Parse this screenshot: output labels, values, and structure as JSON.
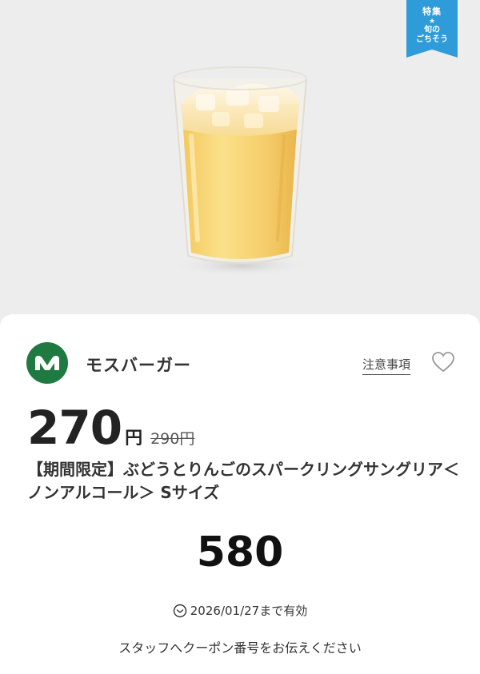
{
  "ribbon": {
    "line1": "特集",
    "star": "★",
    "line2": "旬の",
    "line3": "ごちそう"
  },
  "shop": {
    "name": "モスバーガー",
    "logo_icon": "mos-logo-icon",
    "brand_color": "#1e7a40"
  },
  "actions": {
    "notice_label": "注意事項",
    "favorite_icon": "heart-outline-icon"
  },
  "price": {
    "current": "270",
    "yen": "円",
    "original": "290円"
  },
  "product": {
    "title": "【期間限定】ぶどうとりんごのスパークリングサングリア＜ノンアルコール＞ Sサイズ"
  },
  "coupon": {
    "code": "580",
    "validity": "2026/01/27まで有効",
    "instruction": "スタッフへクーポン番号をお伝えください"
  },
  "colors": {
    "ribbon": "#2f9bd8",
    "background": "#ededed"
  }
}
